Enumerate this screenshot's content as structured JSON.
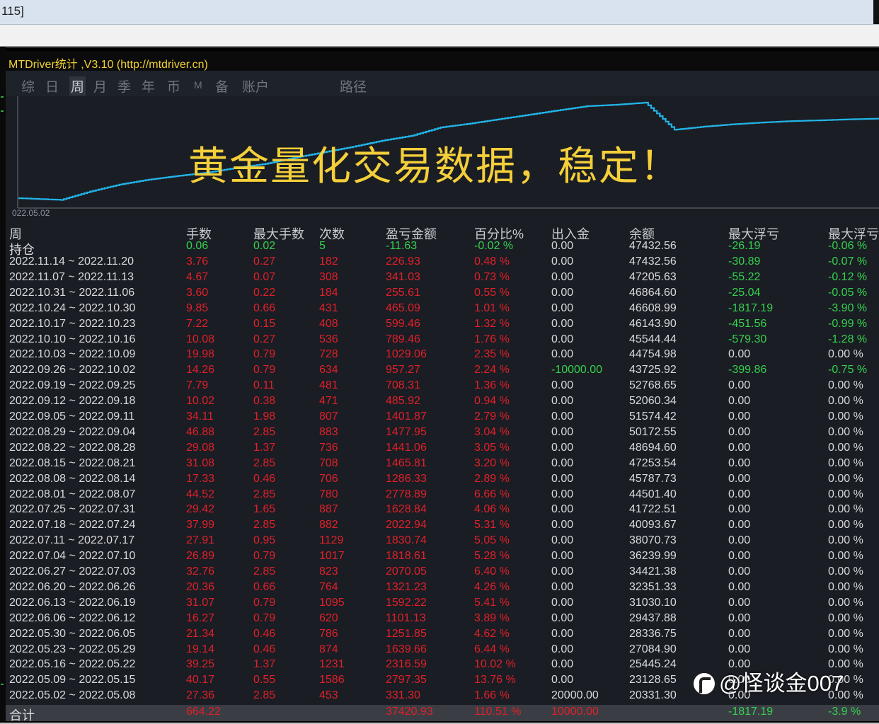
{
  "top_window": {
    "title": "115]"
  },
  "app": {
    "title": "MTDriver统计 ,V3.10 (http://mtdriver.cn)",
    "tabs": [
      {
        "label": "综",
        "active": false
      },
      {
        "label": "日",
        "active": false
      },
      {
        "label": "周",
        "active": true
      },
      {
        "label": "月",
        "active": false
      },
      {
        "label": "季",
        "active": false
      },
      {
        "label": "年",
        "active": false
      },
      {
        "label": "币",
        "active": false
      },
      {
        "label": "M",
        "active": false
      },
      {
        "label": "备",
        "active": false
      },
      {
        "label": "账户",
        "active": false
      },
      {
        "label": "路径",
        "active": false
      }
    ]
  },
  "chart_data": {
    "type": "line",
    "x_start_label": "022.05.02",
    "series_color": "#22b4e8",
    "y_values": [
      20331.3,
      23128.65,
      25445.24,
      27084.9,
      28336.75,
      29437.88,
      31030.1,
      32351.33,
      34421.38,
      36239.99,
      38070.73,
      40093.67,
      41722.51,
      44501.4,
      45787.73,
      47253.54,
      48694.6,
      50172.55,
      51574.42,
      52060.34,
      52768.65,
      43725.92,
      44754.98,
      45544.44,
      46143.9,
      46608.99,
      46864.6,
      47205.63,
      47432.56
    ]
  },
  "overlay_text": "黄金量化交易数据，稳定！",
  "table": {
    "headers": [
      "周",
      "手数",
      "最大手数",
      "次数",
      "盈亏金额",
      "百分比%",
      "出入金",
      "余额",
      "最大浮亏",
      "最大浮亏"
    ],
    "holding": [
      "持仓",
      "0.06",
      "0.02",
      "5",
      "-11.63",
      "-0.02 %",
      "0.00",
      "47432.56",
      "-26.19",
      "-0.06 %"
    ],
    "rows": [
      [
        "2022.11.14 ~ 2022.11.20",
        "3.76",
        "0.27",
        "182",
        "226.93",
        "0.48 %",
        "0.00",
        "47432.56",
        "-30.89",
        "-0.07 %"
      ],
      [
        "2022.11.07 ~ 2022.11.13",
        "4.67",
        "0.07",
        "308",
        "341.03",
        "0.73 %",
        "0.00",
        "47205.63",
        "-55.22",
        "-0.12 %"
      ],
      [
        "2022.10.31 ~ 2022.11.06",
        "3.60",
        "0.22",
        "184",
        "255.61",
        "0.55 %",
        "0.00",
        "46864.60",
        "-25.04",
        "-0.05 %"
      ],
      [
        "2022.10.24 ~ 2022.10.30",
        "9.85",
        "0.66",
        "431",
        "465.09",
        "1.01 %",
        "0.00",
        "46608.99",
        "-1817.19",
        "-3.90 %"
      ],
      [
        "2022.10.17 ~ 2022.10.23",
        "7.22",
        "0.15",
        "408",
        "599.46",
        "1.32 %",
        "0.00",
        "46143.90",
        "-451.56",
        "-0.99 %"
      ],
      [
        "2022.10.10 ~ 2022.10.16",
        "10.08",
        "0.27",
        "536",
        "789.46",
        "1.76 %",
        "0.00",
        "45544.44",
        "-579.30",
        "-1.28 %"
      ],
      [
        "2022.10.03 ~ 2022.10.09",
        "19.98",
        "0.79",
        "728",
        "1029.06",
        "2.35 %",
        "0.00",
        "44754.98",
        "0.00",
        "0.00 %"
      ],
      [
        "2022.09.26 ~ 2022.10.02",
        "14.26",
        "0.79",
        "634",
        "957.27",
        "2.24 %",
        "-10000.00",
        "43725.92",
        "-399.86",
        "-0.75 %"
      ],
      [
        "2022.09.19 ~ 2022.09.25",
        "7.79",
        "0.11",
        "481",
        "708.31",
        "1.36 %",
        "0.00",
        "52768.65",
        "0.00",
        "0.00 %"
      ],
      [
        "2022.09.12 ~ 2022.09.18",
        "10.02",
        "0.38",
        "471",
        "485.92",
        "0.94 %",
        "0.00",
        "52060.34",
        "0.00",
        "0.00 %"
      ],
      [
        "2022.09.05 ~ 2022.09.11",
        "34.11",
        "1.98",
        "807",
        "1401.87",
        "2.79 %",
        "0.00",
        "51574.42",
        "0.00",
        "0.00 %"
      ],
      [
        "2022.08.29 ~ 2022.09.04",
        "46.88",
        "2.85",
        "883",
        "1477.95",
        "3.04 %",
        "0.00",
        "50172.55",
        "0.00",
        "0.00 %"
      ],
      [
        "2022.08.22 ~ 2022.08.28",
        "29.08",
        "1.37",
        "736",
        "1441.06",
        "3.05 %",
        "0.00",
        "48694.60",
        "0.00",
        "0.00 %"
      ],
      [
        "2022.08.15 ~ 2022.08.21",
        "31.08",
        "2.85",
        "708",
        "1465.81",
        "3.20 %",
        "0.00",
        "47253.54",
        "0.00",
        "0.00 %"
      ],
      [
        "2022.08.08 ~ 2022.08.14",
        "17.33",
        "0.46",
        "706",
        "1286.33",
        "2.89 %",
        "0.00",
        "45787.73",
        "0.00",
        "0.00 %"
      ],
      [
        "2022.08.01 ~ 2022.08.07",
        "44.52",
        "2.85",
        "780",
        "2778.89",
        "6.66 %",
        "0.00",
        "44501.40",
        "0.00",
        "0.00 %"
      ],
      [
        "2022.07.25 ~ 2022.07.31",
        "29.42",
        "1.65",
        "887",
        "1628.84",
        "4.06 %",
        "0.00",
        "41722.51",
        "0.00",
        "0.00 %"
      ],
      [
        "2022.07.18 ~ 2022.07.24",
        "37.99",
        "2.85",
        "882",
        "2022.94",
        "5.31 %",
        "0.00",
        "40093.67",
        "0.00",
        "0.00 %"
      ],
      [
        "2022.07.11 ~ 2022.07.17",
        "27.91",
        "0.95",
        "1129",
        "1830.74",
        "5.05 %",
        "0.00",
        "38070.73",
        "0.00",
        "0.00 %"
      ],
      [
        "2022.07.04 ~ 2022.07.10",
        "26.89",
        "0.79",
        "1017",
        "1818.61",
        "5.28 %",
        "0.00",
        "36239.99",
        "0.00",
        "0.00 %"
      ],
      [
        "2022.06.27 ~ 2022.07.03",
        "32.76",
        "2.85",
        "823",
        "2070.05",
        "6.40 %",
        "0.00",
        "34421.38",
        "0.00",
        "0.00 %"
      ],
      [
        "2022.06.20 ~ 2022.06.26",
        "20.36",
        "0.66",
        "764",
        "1321.23",
        "4.26 %",
        "0.00",
        "32351.33",
        "0.00",
        "0.00 %"
      ],
      [
        "2022.06.13 ~ 2022.06.19",
        "31.07",
        "0.79",
        "1095",
        "1592.22",
        "5.41 %",
        "0.00",
        "31030.10",
        "0.00",
        "0.00 %"
      ],
      [
        "2022.06.06 ~ 2022.06.12",
        "16.27",
        "0.79",
        "620",
        "1101.13",
        "3.89 %",
        "0.00",
        "29437.88",
        "0.00",
        "0.00 %"
      ],
      [
        "2022.05.30 ~ 2022.06.05",
        "21.34",
        "0.46",
        "786",
        "1251.85",
        "4.62 %",
        "0.00",
        "28336.75",
        "0.00",
        "0.00 %"
      ],
      [
        "2022.05.23 ~ 2022.05.29",
        "19.14",
        "0.46",
        "874",
        "1639.66",
        "6.44 %",
        "0.00",
        "27084.90",
        "0.00",
        "0.00 %"
      ],
      [
        "2022.05.16 ~ 2022.05.22",
        "39.25",
        "1.37",
        "1231",
        "2316.59",
        "10.02 %",
        "0.00",
        "25445.24",
        "0.00",
        "0.00 %"
      ],
      [
        "2022.05.09 ~ 2022.05.15",
        "40.17",
        "0.55",
        "1586",
        "2797.35",
        "13.76 %",
        "0.00",
        "23128.65",
        "0.00",
        "0.00 %"
      ],
      [
        "2022.05.02 ~ 2022.05.08",
        "27.36",
        "2.85",
        "453",
        "331.30",
        "1.66 %",
        "20000.00",
        "20331.30",
        "0.00",
        "0.00 %"
      ]
    ],
    "total": [
      "合计",
      "664.22",
      "",
      "",
      "37420.93",
      "110.51 %",
      "10000.00",
      "",
      "-1817.19",
      "-3.9 %"
    ]
  },
  "watermark": "@怪谈金007",
  "colors": {
    "positive": "#e0202a",
    "negative": "#35d14f",
    "neutral": "#d8dade",
    "accent_text": "#f4cf3a",
    "curve": "#22b4e8"
  }
}
